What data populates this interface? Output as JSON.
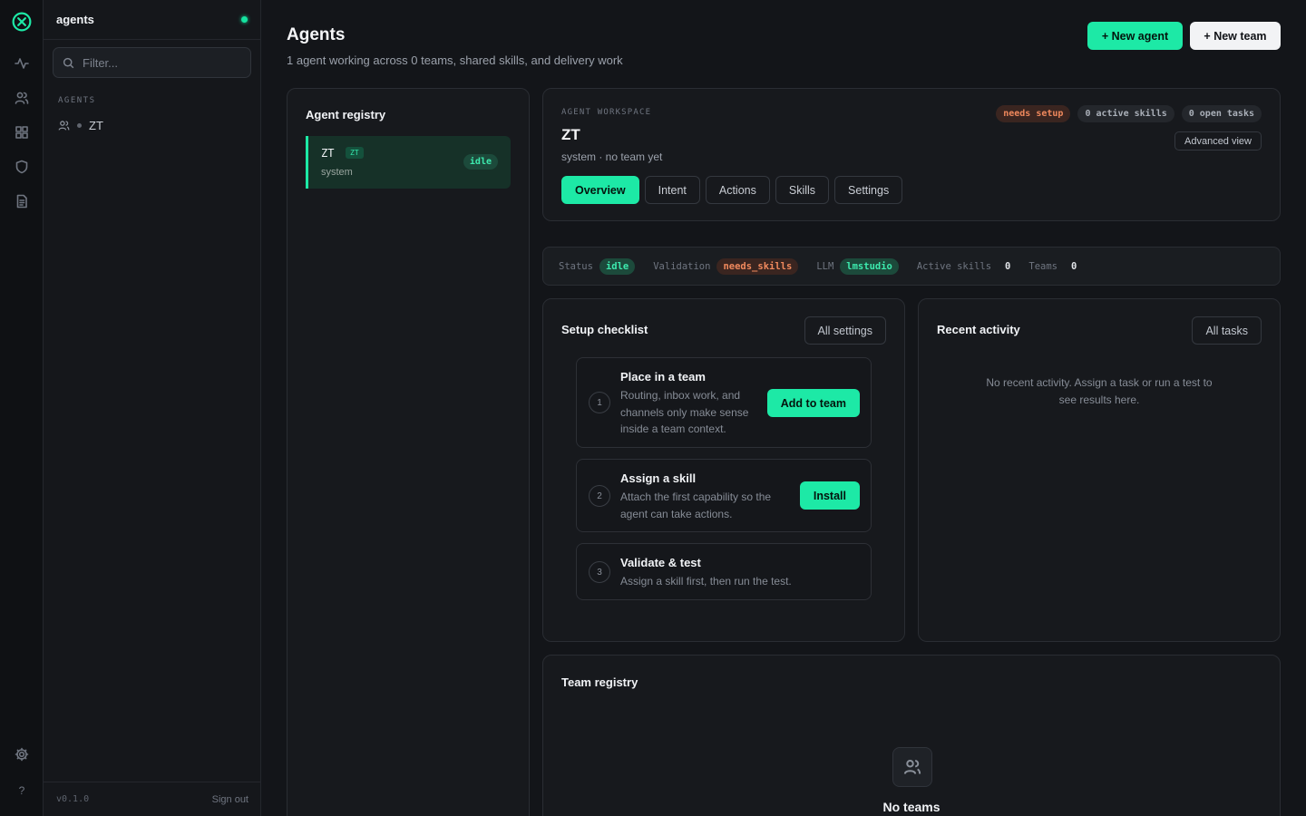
{
  "app": {
    "section": "agents",
    "version": "v0.1.0",
    "sign_out": "Sign out"
  },
  "rail": {
    "icons": [
      "logo-icon",
      "activity-icon",
      "users-icon",
      "grid-icon",
      "shield-icon",
      "document-icon",
      "settings-icon"
    ],
    "help": "?"
  },
  "sidebar": {
    "filter_placeholder": "Filter...",
    "section_label": "AGENTS",
    "items": [
      {
        "label": "ZT"
      }
    ]
  },
  "header": {
    "title": "Agents",
    "subtitle": "1 agent working across 0 teams, shared skills, and delivery work",
    "new_agent": "+ New agent",
    "new_team": "+ New team"
  },
  "registry": {
    "title": "Agent registry",
    "items": [
      {
        "name": "ZT",
        "tag": "ZT",
        "role": "system",
        "status": "idle"
      }
    ]
  },
  "workspace": {
    "label": "AGENT WORKSPACE",
    "name": "ZT",
    "subtitle": "system · no team yet",
    "badges": {
      "setup": "needs setup",
      "skills": "0 active skills",
      "tasks": "0 open tasks"
    },
    "advanced": "Advanced view",
    "tabs": [
      "Overview",
      "Intent",
      "Actions",
      "Skills",
      "Settings"
    ]
  },
  "status_strip": {
    "status_label": "Status",
    "status_value": "idle",
    "validation_label": "Validation",
    "validation_value": "needs_skills",
    "llm_label": "LLM",
    "llm_value": "lmstudio",
    "active_skills_label": "Active skills",
    "active_skills_value": "0",
    "teams_label": "Teams",
    "teams_value": "0"
  },
  "checklist": {
    "title": "Setup checklist",
    "all_settings": "All settings",
    "steps": [
      {
        "num": "1",
        "title": "Place in a team",
        "desc_lines": [
          "Routing, inbox work, and",
          "channels only make sense",
          "inside a team context."
        ],
        "action": "Add to team"
      },
      {
        "num": "2",
        "title": "Assign a skill",
        "desc_lines": [
          "Attach the first capability so the",
          "agent can take actions."
        ],
        "action": "Install"
      },
      {
        "num": "3",
        "title": "Validate & test",
        "desc_lines": [
          "Assign a skill first, then run the test."
        ]
      }
    ]
  },
  "activity": {
    "title": "Recent activity",
    "all_tasks": "All tasks",
    "empty_lines": [
      "No recent activity. Assign a task or run a test to",
      "see results here."
    ]
  },
  "teams": {
    "title": "Team registry",
    "empty_title": "No teams"
  },
  "colors": {
    "accent": "#1de9a6",
    "warn": "#f0895d",
    "background": "#131519"
  }
}
